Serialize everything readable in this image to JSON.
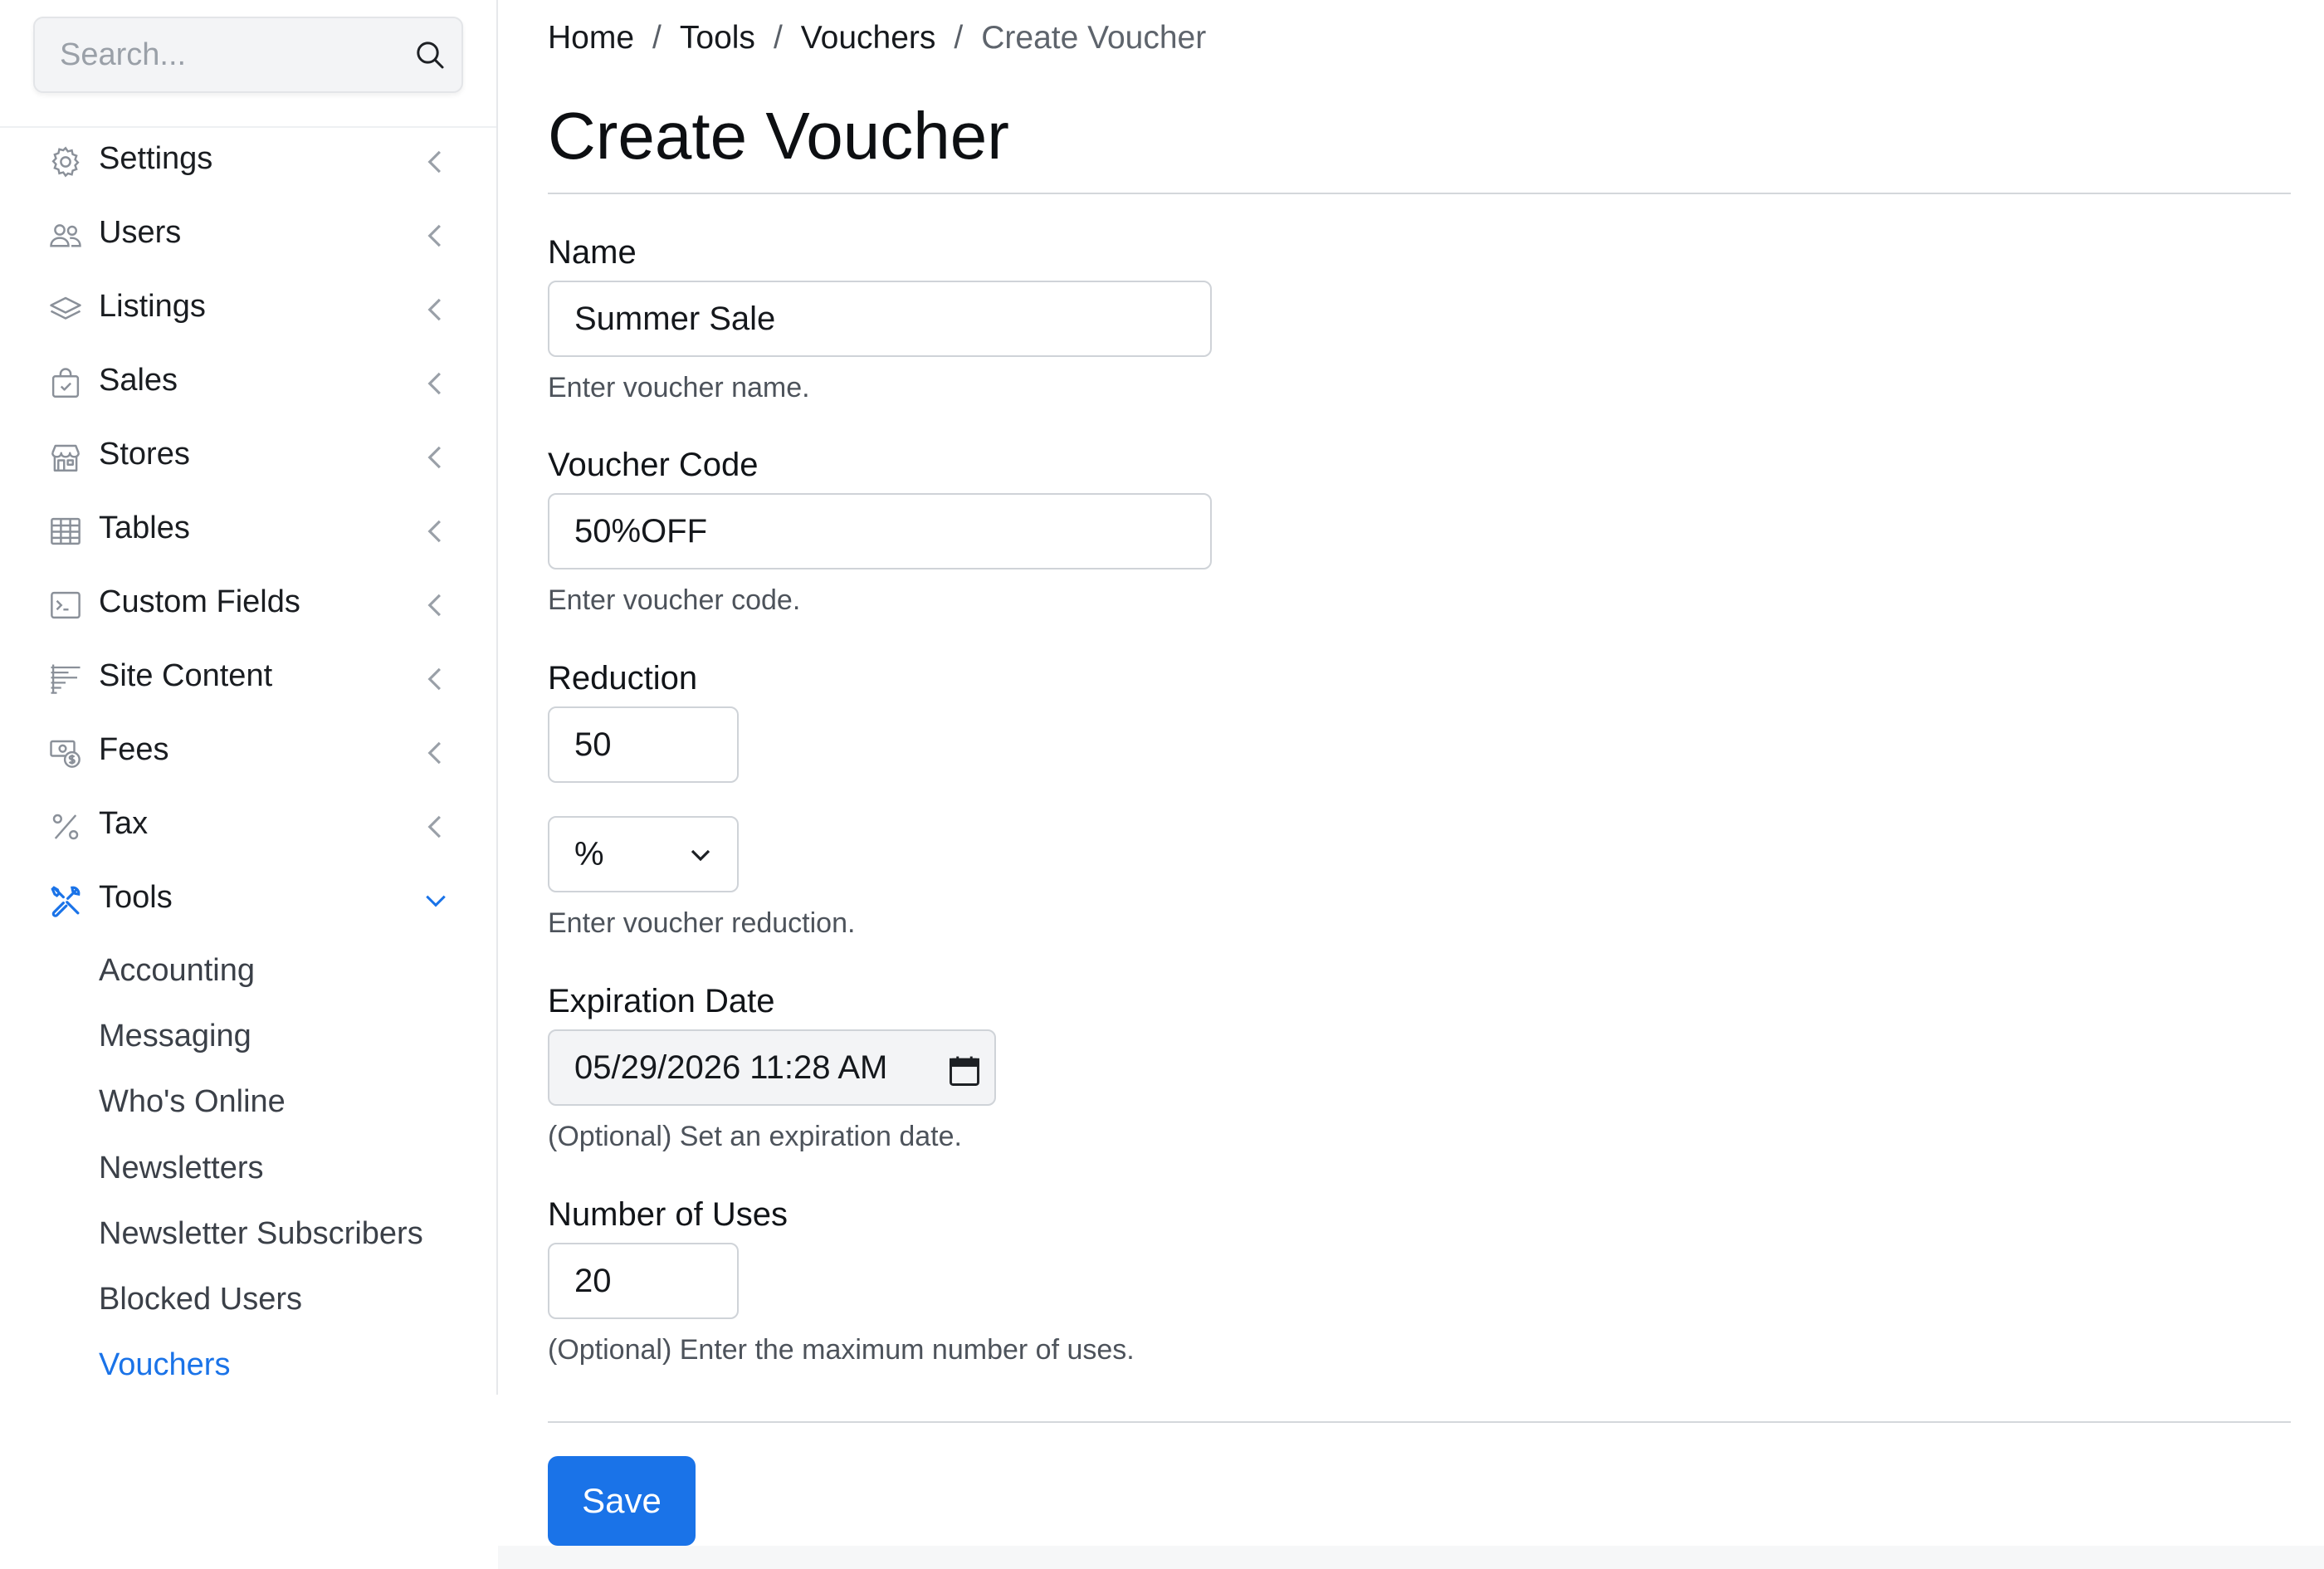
{
  "search": {
    "placeholder": "Search..."
  },
  "sidebar": {
    "items": [
      {
        "label": "Settings",
        "icon": "gear-icon"
      },
      {
        "label": "Users",
        "icon": "users-icon"
      },
      {
        "label": "Listings",
        "icon": "layers-icon"
      },
      {
        "label": "Sales",
        "icon": "shopping-bag-icon"
      },
      {
        "label": "Stores",
        "icon": "store-icon"
      },
      {
        "label": "Tables",
        "icon": "table-icon"
      },
      {
        "label": "Custom Fields",
        "icon": "terminal-icon"
      },
      {
        "label": "Site Content",
        "icon": "text-lines-icon"
      },
      {
        "label": "Fees",
        "icon": "money-icon"
      },
      {
        "label": "Tax",
        "icon": "percent-icon"
      },
      {
        "label": "Tools",
        "icon": "tools-icon",
        "expanded": true
      }
    ],
    "tools_subitems": [
      {
        "label": "Accounting"
      },
      {
        "label": "Messaging"
      },
      {
        "label": "Who's Online"
      },
      {
        "label": "Newsletters"
      },
      {
        "label": "Newsletter Subscribers"
      },
      {
        "label": "Blocked Users"
      },
      {
        "label": "Vouchers",
        "active": true
      }
    ]
  },
  "breadcrumb": {
    "items": [
      "Home",
      "Tools",
      "Vouchers"
    ],
    "current": "Create Voucher",
    "separator": "/"
  },
  "page": {
    "title": "Create Voucher"
  },
  "form": {
    "name": {
      "label": "Name",
      "value": "Summer Sale",
      "help": "Enter voucher name."
    },
    "code": {
      "label": "Voucher Code",
      "value": "50%OFF",
      "help": "Enter voucher code."
    },
    "reduction": {
      "label": "Reduction",
      "value": "50",
      "unit": "%",
      "help": "Enter voucher reduction."
    },
    "expiration": {
      "label": "Expiration Date",
      "value": "05/29/2026 11:28 AM",
      "help": "(Optional) Set an expiration date."
    },
    "uses": {
      "label": "Number of Uses",
      "value": "20",
      "help": "(Optional) Enter the maximum number of uses."
    }
  },
  "actions": {
    "save_label": "Save"
  },
  "colors": {
    "accent": "#1a73e8",
    "text": "#111418",
    "muted": "#4d535b",
    "border": "#cfd3d8"
  }
}
